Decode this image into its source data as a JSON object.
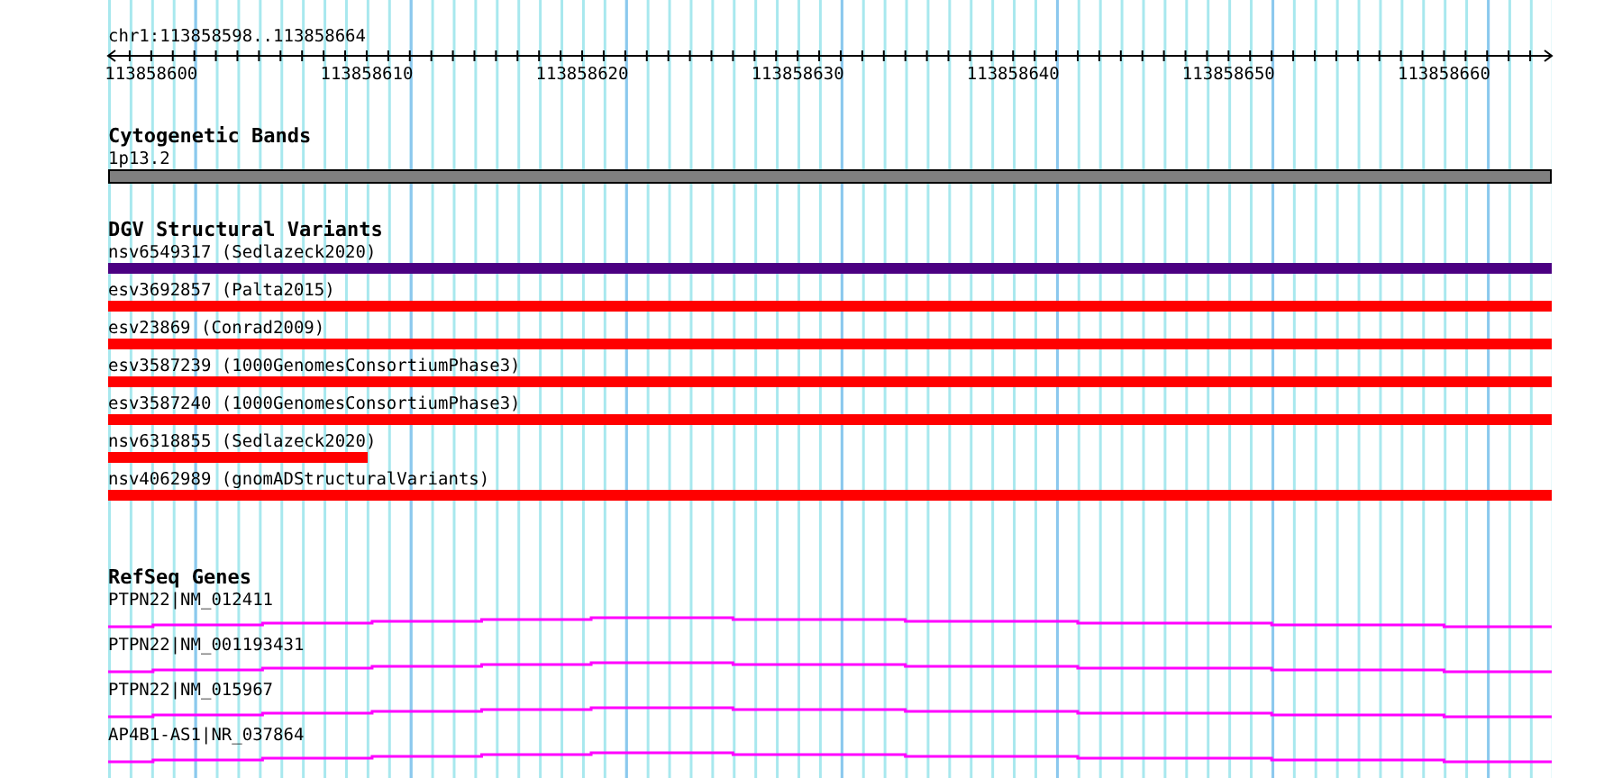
{
  "ruler": {
    "location": "chr1:113858598..113858664",
    "ticks": [
      "113858600",
      "113858610",
      "113858620",
      "113858630",
      "113858640",
      "113858650",
      "113858660"
    ]
  },
  "tracks": [
    {
      "kind": "bands",
      "title": "Cytogenetic Bands",
      "features": [
        {
          "label": "1p13.2",
          "color": "#808080",
          "level": 1
        }
      ]
    },
    {
      "kind": "variants",
      "title": "DGV Structural Variants",
      "features": [
        {
          "label": "nsv6549317 (Sedlazeck2020)",
          "color": "#4b0082",
          "level": 1
        },
        {
          "label": "esv3692857 (Palta2015)",
          "color": "#ff0000",
          "level": 1
        },
        {
          "label": "esv23869 (Conrad2009)",
          "color": "#ff0000",
          "level": 1
        },
        {
          "label": "esv3587239 (1000GenomesConsortiumPhase3)",
          "color": "#ff0000",
          "level": 1
        },
        {
          "label": "esv3587240 (1000GenomesConsortiumPhase3)",
          "color": "#ff0000",
          "level": 1
        },
        {
          "label": "nsv6318855 (Sedlazeck2020)",
          "color": "#ff0000",
          "level": 0.18
        },
        {
          "label": "nsv4062989 (gnomADStructuralVariants)",
          "color": "#ff0000",
          "level": 1
        }
      ]
    },
    {
      "kind": "genes",
      "title": "RefSeq Genes",
      "features": [
        {
          "label": "PTPN22|NM_012411",
          "color": "#ff00ff"
        },
        {
          "label": "PTPN22|NM_001193431",
          "color": "#ff00ff"
        },
        {
          "label": "PTPN22|NM_015967",
          "color": "#ff00ff"
        },
        {
          "label": "AP4B1-AS1|NR_037864",
          "color": "#ff00ff"
        }
      ]
    }
  ]
}
